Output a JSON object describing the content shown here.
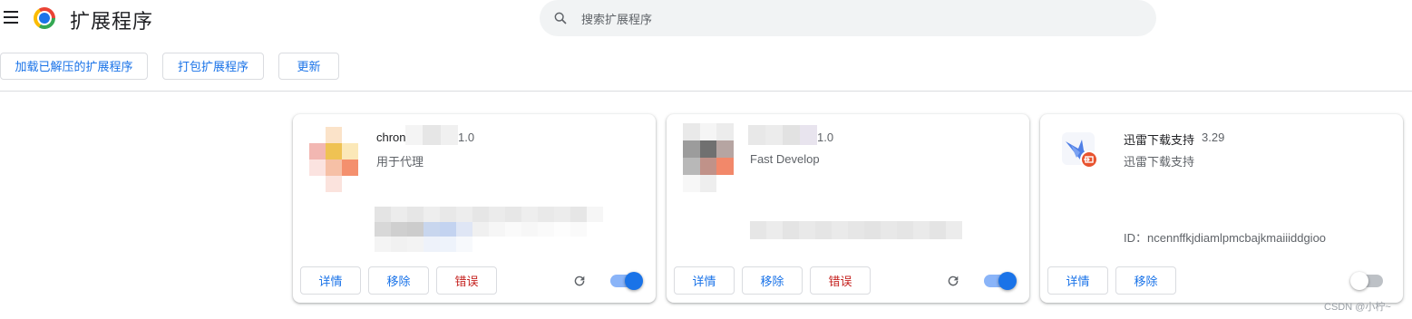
{
  "header": {
    "title": "扩展程序",
    "search_placeholder": "搜索扩展程序"
  },
  "toolbar": {
    "load_unpacked": "加载已解压的扩展程序",
    "pack": "打包扩展程序",
    "update": "更新"
  },
  "extensions": [
    {
      "name": "chron",
      "version": "1.0",
      "description": "用于代理",
      "enabled": true,
      "buttons": {
        "details": "详情",
        "remove": "移除",
        "errors": "错误"
      }
    },
    {
      "name": "",
      "version": "1.0",
      "description": "Fast Develop",
      "enabled": true,
      "buttons": {
        "details": "详情",
        "remove": "移除",
        "errors": "错误"
      }
    },
    {
      "name": "迅雷下载支持",
      "version": "3.29",
      "description": "迅雷下载支持",
      "id_text": "ID：ncennffkjdiamlpmcbajkmaiiiddgioo",
      "enabled": false,
      "buttons": {
        "details": "详情",
        "remove": "移除"
      }
    }
  ],
  "watermark": "CSDN @小柠~",
  "colors": {
    "accent": "#1a73e8",
    "error": "#c5221f",
    "search_bg": "#f1f3f4"
  }
}
